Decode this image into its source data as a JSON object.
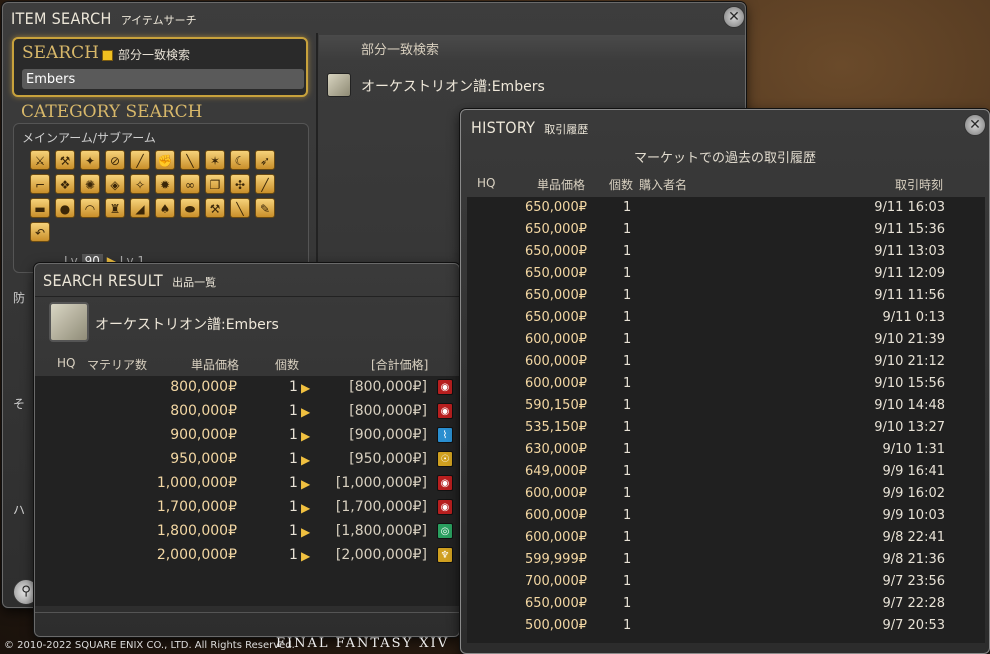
{
  "item_search": {
    "title_en": "ITEM SEARCH",
    "title_jp": "アイテムサーチ",
    "search_label": "SEARCH",
    "partial_match_label": "部分一致検索",
    "search_value": "Embers",
    "category_label": "CATEGORY SEARCH",
    "category_sub": "メインアーム/サブアーム",
    "level_min": "90",
    "level_max_label": "Lv 1",
    "level_prefix": "Lv",
    "result_header": "部分一致検索",
    "result_item": "オーケストリオン譜:Embers",
    "left_stubs": [
      "防",
      "そ",
      "ハ"
    ]
  },
  "search_result": {
    "title_en": "SEARCH RESULT",
    "title_jp": "出品一覧",
    "item_name": "オーケストリオン譜:Embers",
    "columns": {
      "hq": "HQ",
      "materia": "マテリア数",
      "unit_price": "単品価格",
      "qty": "個数",
      "total": "[合計価格]"
    },
    "rows": [
      {
        "price": "800,000₽",
        "qty": "1",
        "total": "[800,000₽]",
        "world_color": "#b81f1f"
      },
      {
        "price": "800,000₽",
        "qty": "1",
        "total": "[800,000₽]",
        "world_color": "#b81f1f"
      },
      {
        "price": "900,000₽",
        "qty": "1",
        "total": "[900,000₽]",
        "world_color": "#2a8fd0"
      },
      {
        "price": "950,000₽",
        "qty": "1",
        "total": "[950,000₽]",
        "world_color": "#d0a020"
      },
      {
        "price": "1,000,000₽",
        "qty": "1",
        "total": "[1,000,000₽]",
        "world_color": "#b81f1f"
      },
      {
        "price": "1,700,000₽",
        "qty": "1",
        "total": "[1,700,000₽]",
        "world_color": "#b81f1f"
      },
      {
        "price": "1,800,000₽",
        "qty": "1",
        "total": "[1,800,000₽]",
        "world_color": "#2aa060"
      },
      {
        "price": "2,000,000₽",
        "qty": "1",
        "total": "[2,000,000₽]",
        "world_color": "#d0a020"
      }
    ]
  },
  "history": {
    "title_en": "HISTORY",
    "title_jp": "取引履歴",
    "subtitle": "マーケットでの過去の取引履歴",
    "columns": {
      "hq": "HQ",
      "unit_price": "単品価格",
      "qty": "個数",
      "buyer": "購入者名",
      "time": "取引時刻"
    },
    "rows": [
      {
        "price": "650,000₽",
        "qty": "1",
        "time": "9/11 16:03"
      },
      {
        "price": "650,000₽",
        "qty": "1",
        "time": "9/11 15:36"
      },
      {
        "price": "650,000₽",
        "qty": "1",
        "time": "9/11 13:03"
      },
      {
        "price": "650,000₽",
        "qty": "1",
        "time": "9/11 12:09"
      },
      {
        "price": "650,000₽",
        "qty": "1",
        "time": "9/11 11:56"
      },
      {
        "price": "650,000₽",
        "qty": "1",
        "time": "9/11 0:13"
      },
      {
        "price": "600,000₽",
        "qty": "1",
        "time": "9/10 21:39"
      },
      {
        "price": "600,000₽",
        "qty": "1",
        "time": "9/10 21:12"
      },
      {
        "price": "600,000₽",
        "qty": "1",
        "time": "9/10 15:56"
      },
      {
        "price": "590,150₽",
        "qty": "1",
        "time": "9/10 14:48"
      },
      {
        "price": "535,150₽",
        "qty": "1",
        "time": "9/10 13:27"
      },
      {
        "price": "630,000₽",
        "qty": "1",
        "time": "9/10 1:31"
      },
      {
        "price": "649,000₽",
        "qty": "1",
        "time": "9/9 16:41"
      },
      {
        "price": "600,000₽",
        "qty": "1",
        "time": "9/9 16:02"
      },
      {
        "price": "600,000₽",
        "qty": "1",
        "time": "9/9 10:03"
      },
      {
        "price": "600,000₽",
        "qty": "1",
        "time": "9/8 22:41"
      },
      {
        "price": "599,999₽",
        "qty": "1",
        "time": "9/8 21:36"
      },
      {
        "price": "700,000₽",
        "qty": "1",
        "time": "9/7 23:56"
      },
      {
        "price": "650,000₽",
        "qty": "1",
        "time": "9/7 22:28"
      },
      {
        "price": "500,000₽",
        "qty": "1",
        "time": "9/7 20:53"
      }
    ]
  },
  "footer": {
    "copyright": "© 2010-2022 SQUARE ENIX CO., LTD. All Rights Reserved.",
    "logo": "FINAL FANTASY XIV"
  }
}
